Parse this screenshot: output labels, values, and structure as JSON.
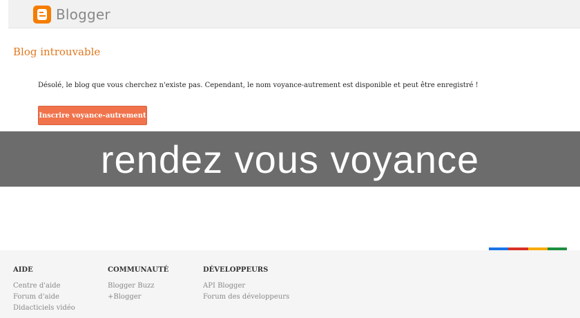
{
  "header": {
    "logo_text": "Blogger"
  },
  "main": {
    "title": "Blog introuvable",
    "message": "Désolé, le blog que vous cherchez n'existe pas. Cependant, le nom voyance-autrement est disponible et peut être enregistré !",
    "register_button": "Inscrire voyance-autrement"
  },
  "banner": {
    "text": "rendez vous voyance"
  },
  "footer": {
    "color_bar": [
      "#1a73e8",
      "#d93025",
      "#f9ab00",
      "#1e8e3e"
    ],
    "columns": [
      {
        "heading": "AIDE",
        "links": [
          "Centre d'aide",
          "Forum d'aide",
          "Didacticiels vidéo"
        ]
      },
      {
        "heading": "COMMUNAUTÉ",
        "links": [
          "Blogger Buzz",
          "+Blogger"
        ]
      },
      {
        "heading": "DÉVELOPPEURS",
        "links": [
          "API Blogger",
          "Forum des développeurs"
        ]
      }
    ]
  }
}
